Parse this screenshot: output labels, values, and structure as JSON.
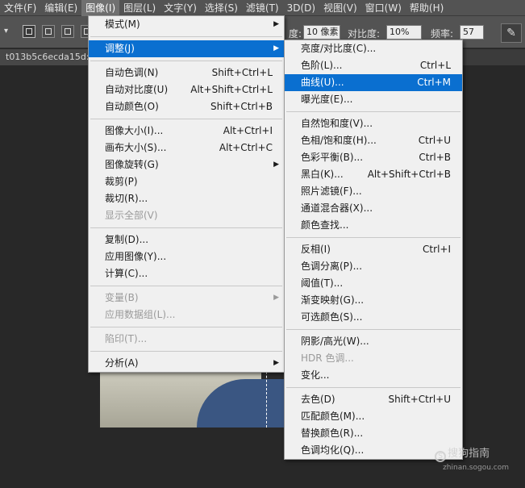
{
  "menubar": {
    "items": [
      {
        "label": "文件(F)",
        "active": false
      },
      {
        "label": "编辑(E)",
        "active": false
      },
      {
        "label": "图像(I)",
        "active": true
      },
      {
        "label": "图层(L)",
        "active": false
      },
      {
        "label": "文字(Y)",
        "active": false
      },
      {
        "label": "选择(S)",
        "active": false
      },
      {
        "label": "滤镜(T)",
        "active": false
      },
      {
        "label": "3D(D)",
        "active": false
      },
      {
        "label": "视图(V)",
        "active": false
      },
      {
        "label": "窗口(W)",
        "active": false
      },
      {
        "label": "帮助(H)",
        "active": false
      }
    ]
  },
  "options": {
    "partial_label": "度:",
    "width_value": "10 像素",
    "contrast_label": "对比度:",
    "contrast_value": "10%",
    "frequency_label": "频率:",
    "frequency_value": "57"
  },
  "document": {
    "tab_title": "t013b5c6ecda15d:"
  },
  "image_menu": {
    "items": [
      {
        "type": "item",
        "label": "模式(M)",
        "shortcut": "",
        "submenu": true,
        "disabled": false
      },
      {
        "type": "sep"
      },
      {
        "type": "item",
        "label": "调整(J)",
        "shortcut": "",
        "submenu": true,
        "disabled": false,
        "highlighted": true
      },
      {
        "type": "sep"
      },
      {
        "type": "item",
        "label": "自动色调(N)",
        "shortcut": "Shift+Ctrl+L",
        "submenu": false,
        "disabled": false
      },
      {
        "type": "item",
        "label": "自动对比度(U)",
        "shortcut": "Alt+Shift+Ctrl+L",
        "submenu": false,
        "disabled": false
      },
      {
        "type": "item",
        "label": "自动颜色(O)",
        "shortcut": "Shift+Ctrl+B",
        "submenu": false,
        "disabled": false
      },
      {
        "type": "sep"
      },
      {
        "type": "item",
        "label": "图像大小(I)...",
        "shortcut": "Alt+Ctrl+I",
        "submenu": false,
        "disabled": false
      },
      {
        "type": "item",
        "label": "画布大小(S)...",
        "shortcut": "Alt+Ctrl+C",
        "submenu": false,
        "disabled": false
      },
      {
        "type": "item",
        "label": "图像旋转(G)",
        "shortcut": "",
        "submenu": true,
        "disabled": false
      },
      {
        "type": "item",
        "label": "裁剪(P)",
        "shortcut": "",
        "submenu": false,
        "disabled": false
      },
      {
        "type": "item",
        "label": "裁切(R)...",
        "shortcut": "",
        "submenu": false,
        "disabled": false
      },
      {
        "type": "item",
        "label": "显示全部(V)",
        "shortcut": "",
        "submenu": false,
        "disabled": true
      },
      {
        "type": "sep"
      },
      {
        "type": "item",
        "label": "复制(D)...",
        "shortcut": "",
        "submenu": false,
        "disabled": false
      },
      {
        "type": "item",
        "label": "应用图像(Y)...",
        "shortcut": "",
        "submenu": false,
        "disabled": false
      },
      {
        "type": "item",
        "label": "计算(C)...",
        "shortcut": "",
        "submenu": false,
        "disabled": false
      },
      {
        "type": "sep"
      },
      {
        "type": "item",
        "label": "变量(B)",
        "shortcut": "",
        "submenu": true,
        "disabled": true
      },
      {
        "type": "item",
        "label": "应用数据组(L)...",
        "shortcut": "",
        "submenu": false,
        "disabled": true
      },
      {
        "type": "sep"
      },
      {
        "type": "item",
        "label": "陷印(T)...",
        "shortcut": "",
        "submenu": false,
        "disabled": true
      },
      {
        "type": "sep"
      },
      {
        "type": "item",
        "label": "分析(A)",
        "shortcut": "",
        "submenu": true,
        "disabled": false
      }
    ]
  },
  "adjust_menu": {
    "items": [
      {
        "type": "item",
        "label": "亮度/对比度(C)...",
        "shortcut": "",
        "disabled": false
      },
      {
        "type": "item",
        "label": "色阶(L)...",
        "shortcut": "Ctrl+L",
        "disabled": false
      },
      {
        "type": "item",
        "label": "曲线(U)...",
        "shortcut": "Ctrl+M",
        "disabled": false,
        "highlighted": true
      },
      {
        "type": "item",
        "label": "曝光度(E)...",
        "shortcut": "",
        "disabled": false
      },
      {
        "type": "sep"
      },
      {
        "type": "item",
        "label": "自然饱和度(V)...",
        "shortcut": "",
        "disabled": false
      },
      {
        "type": "item",
        "label": "色相/饱和度(H)...",
        "shortcut": "Ctrl+U",
        "disabled": false
      },
      {
        "type": "item",
        "label": "色彩平衡(B)...",
        "shortcut": "Ctrl+B",
        "disabled": false
      },
      {
        "type": "item",
        "label": "黑白(K)...",
        "shortcut": "Alt+Shift+Ctrl+B",
        "disabled": false
      },
      {
        "type": "item",
        "label": "照片滤镜(F)...",
        "shortcut": "",
        "disabled": false
      },
      {
        "type": "item",
        "label": "通道混合器(X)...",
        "shortcut": "",
        "disabled": false
      },
      {
        "type": "item",
        "label": "颜色查找...",
        "shortcut": "",
        "disabled": false
      },
      {
        "type": "sep"
      },
      {
        "type": "item",
        "label": "反相(I)",
        "shortcut": "Ctrl+I",
        "disabled": false
      },
      {
        "type": "item",
        "label": "色调分离(P)...",
        "shortcut": "",
        "disabled": false
      },
      {
        "type": "item",
        "label": "阈值(T)...",
        "shortcut": "",
        "disabled": false
      },
      {
        "type": "item",
        "label": "渐变映射(G)...",
        "shortcut": "",
        "disabled": false
      },
      {
        "type": "item",
        "label": "可选颜色(S)...",
        "shortcut": "",
        "disabled": false
      },
      {
        "type": "sep"
      },
      {
        "type": "item",
        "label": "阴影/高光(W)...",
        "shortcut": "",
        "disabled": false
      },
      {
        "type": "item",
        "label": "HDR 色调...",
        "shortcut": "",
        "disabled": true
      },
      {
        "type": "item",
        "label": "变化...",
        "shortcut": "",
        "disabled": false
      },
      {
        "type": "sep"
      },
      {
        "type": "item",
        "label": "去色(D)",
        "shortcut": "Shift+Ctrl+U",
        "disabled": false
      },
      {
        "type": "item",
        "label": "匹配颜色(M)...",
        "shortcut": "",
        "disabled": false
      },
      {
        "type": "item",
        "label": "替换颜色(R)...",
        "shortcut": "",
        "disabled": false
      },
      {
        "type": "item",
        "label": "色调均化(Q)...",
        "shortcut": "",
        "disabled": false
      }
    ]
  },
  "watermark": {
    "logo_mark": "S",
    "logo_text": "搜狗指南",
    "url": "zhinan.sogou.com"
  },
  "colors": {
    "highlight": "#0a6fd0",
    "menu_bg": "#f0f0f0",
    "workspace_bg": "#282828",
    "panel_bg": "#535353"
  }
}
